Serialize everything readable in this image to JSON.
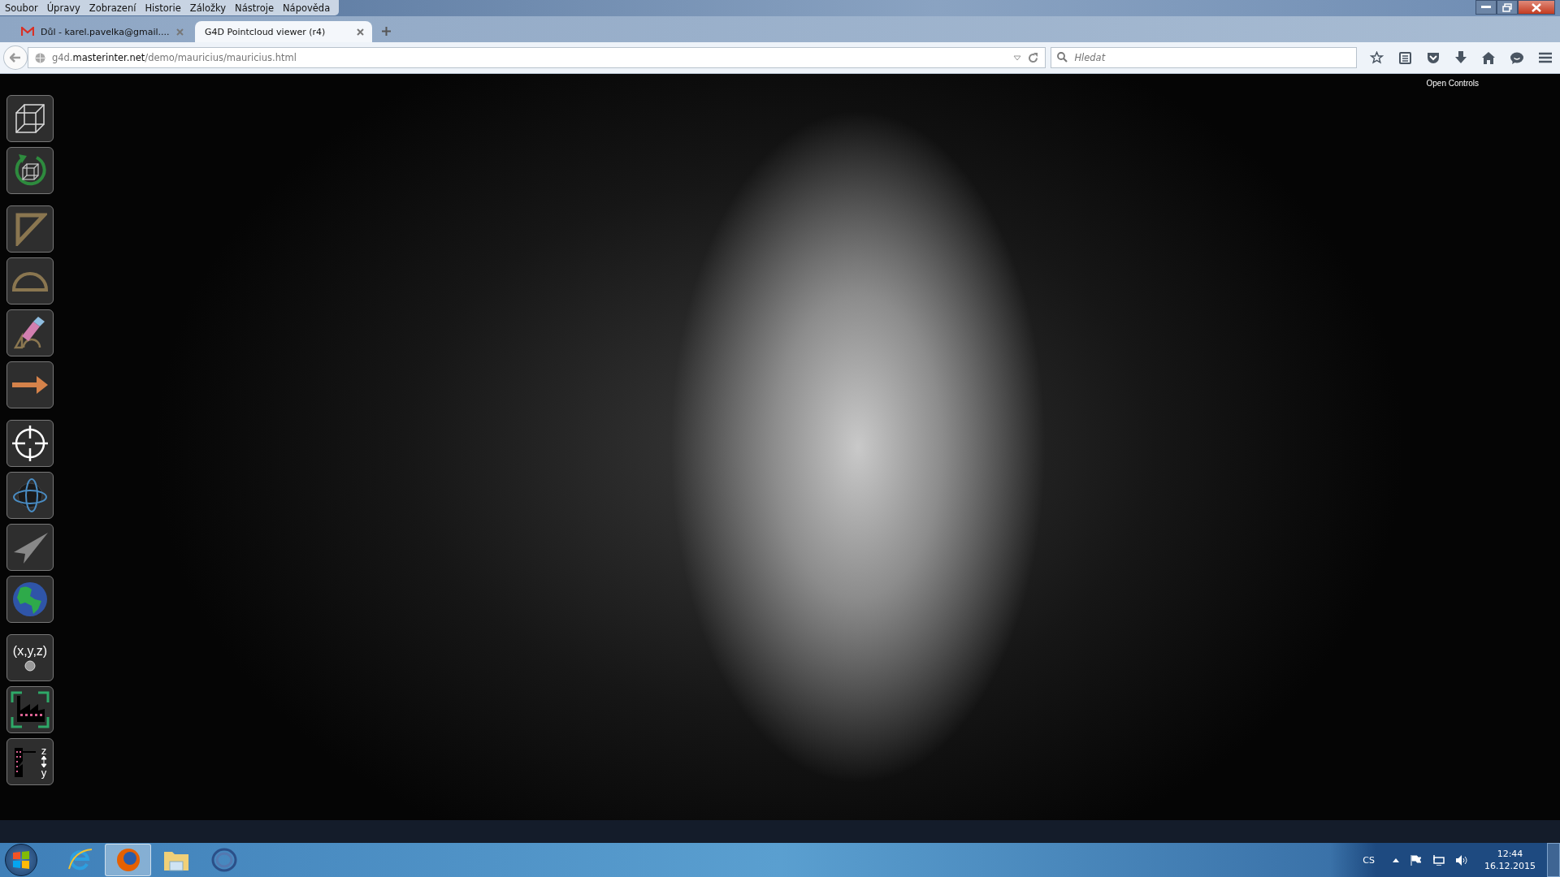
{
  "menu": [
    "Soubor",
    "Úpravy",
    "Zobrazení",
    "Historie",
    "Záložky",
    "Nástroje",
    "Nápověda"
  ],
  "tabs": [
    {
      "title": "Důl - karel.pavelka@gmail....",
      "kind": "mail",
      "selected": false
    },
    {
      "title": "G4D Pointcloud viewer (r4)",
      "kind": "page",
      "selected": true
    }
  ],
  "address": {
    "prefix": "g4d.",
    "domain": "masterinter.net",
    "path": "/demo/mauricius/mauricius.html"
  },
  "search": {
    "placeholder": "Hledat"
  },
  "viewer": {
    "open_controls": "Open Controls",
    "tool_groups": [
      [
        {
          "kind": "cube"
        },
        {
          "kind": "rotate"
        }
      ],
      [
        {
          "kind": "triangle"
        },
        {
          "kind": "protractor"
        },
        {
          "kind": "eraser"
        },
        {
          "kind": "arrow"
        }
      ],
      [
        {
          "kind": "crosshair"
        },
        {
          "kind": "orbit"
        },
        {
          "kind": "plane"
        },
        {
          "kind": "globe"
        }
      ],
      [
        {
          "kind": "coords",
          "label": "(x,y,z)"
        },
        {
          "kind": "factory"
        },
        {
          "kind": "profile",
          "top": "z",
          "bottom": "y"
        }
      ]
    ]
  },
  "taskbar": {
    "apps": [
      {
        "kind": "ie",
        "selected": false
      },
      {
        "kind": "firefox",
        "selected": true
      },
      {
        "kind": "folder",
        "selected": false
      },
      {
        "kind": "ring",
        "selected": false
      }
    ],
    "language": "CS",
    "time": "12:44",
    "date": "16.12.2015"
  }
}
